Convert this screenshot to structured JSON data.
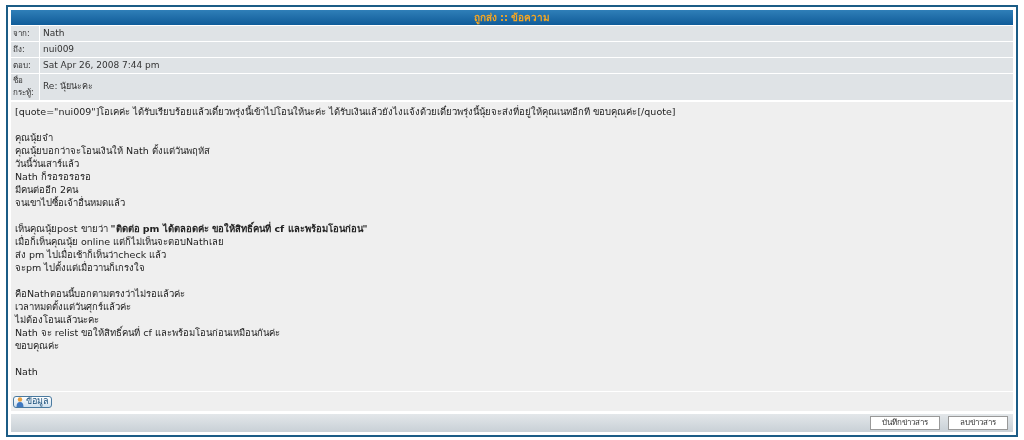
{
  "header": {
    "title": "ถูกส่ง :: ข้อความ"
  },
  "fields": [
    {
      "label": "จาก:",
      "value": "Nath"
    },
    {
      "label": "ถึง:",
      "value": "nui009"
    },
    {
      "label": "ตอบ:",
      "value": "Sat Apr 26, 2008 7:44 pm"
    },
    {
      "label": "ชื่อ กระทู้:",
      "value": "Re: นุ้ยนะคะ"
    }
  ],
  "message": {
    "paragraphs": [
      [
        "[quote=\"nui009\"]โอเคค่ะ ได้รับเรียบร้อยแล้วเดี๋ยวพรุ่งนี้เข้าไปโอนให้นะค่ะ ได้รับเงินแล้วยังไงแจ้งด้วยเดี๋ยวพรุ่งนี้นุ้ยจะส่งที่อยู่ให้คุณเนทอีกที ขอบคุณค่ะ[/quote]"
      ],
      [
        "คุณนุ้ยจ๋า",
        "คุณนุ้ยบอกว่าจะโอนเงินให้ Nath ตั้งแต่วันพฤหัส",
        "วันนี้วันเสาร์แล้ว",
        "Nath ก็รอรอรอรอ",
        "มีคนต่ออีก 2คน",
        "จนเขาไปซื้อเจ้าอื่นหมดแล้ว"
      ],
      [
        "เห็นคุณนุ้ยpost ขายว่า **\"ติดต่อ pm ได้ตลอดค่ะ ขอให้สิทธิ์คนที่ cf และพร้อมโอนก่อน\"**",
        "เมื่อก็เห็นคุณนุ้ย online แต่ก็ไม่เห็นจะตอบNathเลย",
        "ส่ง pm ไปเมื่อเช้าก็เห็นว่าcheck แล้ว",
        "จะpm ไปตั้งแต่เมื่อวานก็เกรงใจ"
      ],
      [
        "คือNathตอนนี้บอกตามตรงว่าไม่รอแล้วค่ะ",
        "เวลาหมดตั้งแต่วันศุกร์แล้วค่ะ",
        "ไม่ต้องโอนแล้วนะคะ",
        "Nath จะ relist ขอให้สิทธิ์คนที่ cf และพร้อมโอนก่อนเหมือนกันค่ะ",
        "ขอบคุณค่ะ"
      ],
      [
        "Nath"
      ]
    ]
  },
  "profile_button": "ข้อมูล",
  "footer_buttons": [
    "บันทึกข่าวสาร",
    "ลบข่าวสาร"
  ]
}
